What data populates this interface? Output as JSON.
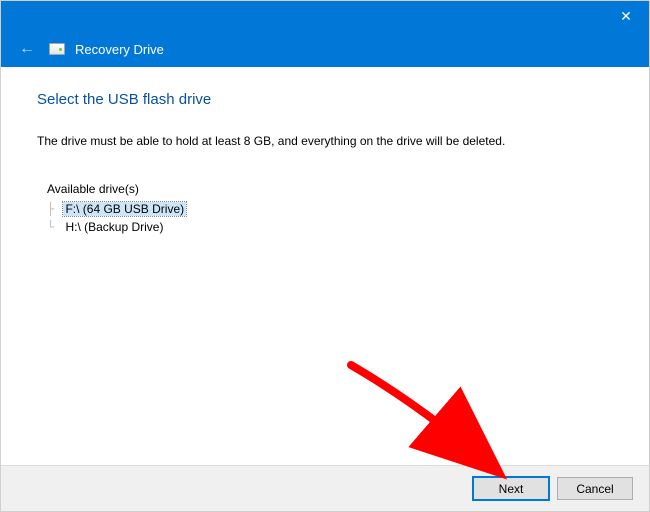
{
  "titlebar": {
    "close_label": "✕"
  },
  "header": {
    "back_label": "←",
    "title": "Recovery Drive"
  },
  "main": {
    "heading": "Select the USB flash drive",
    "instruction": "The drive must be able to hold at least 8 GB, and everything on the drive will be deleted.",
    "tree_label": "Available drive(s)",
    "drives": [
      {
        "label": "F:\\ (64 GB USB Drive)",
        "selected": true
      },
      {
        "label": "H:\\ (Backup Drive)",
        "selected": false
      }
    ]
  },
  "footer": {
    "next_label": "Next",
    "cancel_label": "Cancel"
  },
  "annotation": {
    "arrow_color": "#ff0000"
  }
}
